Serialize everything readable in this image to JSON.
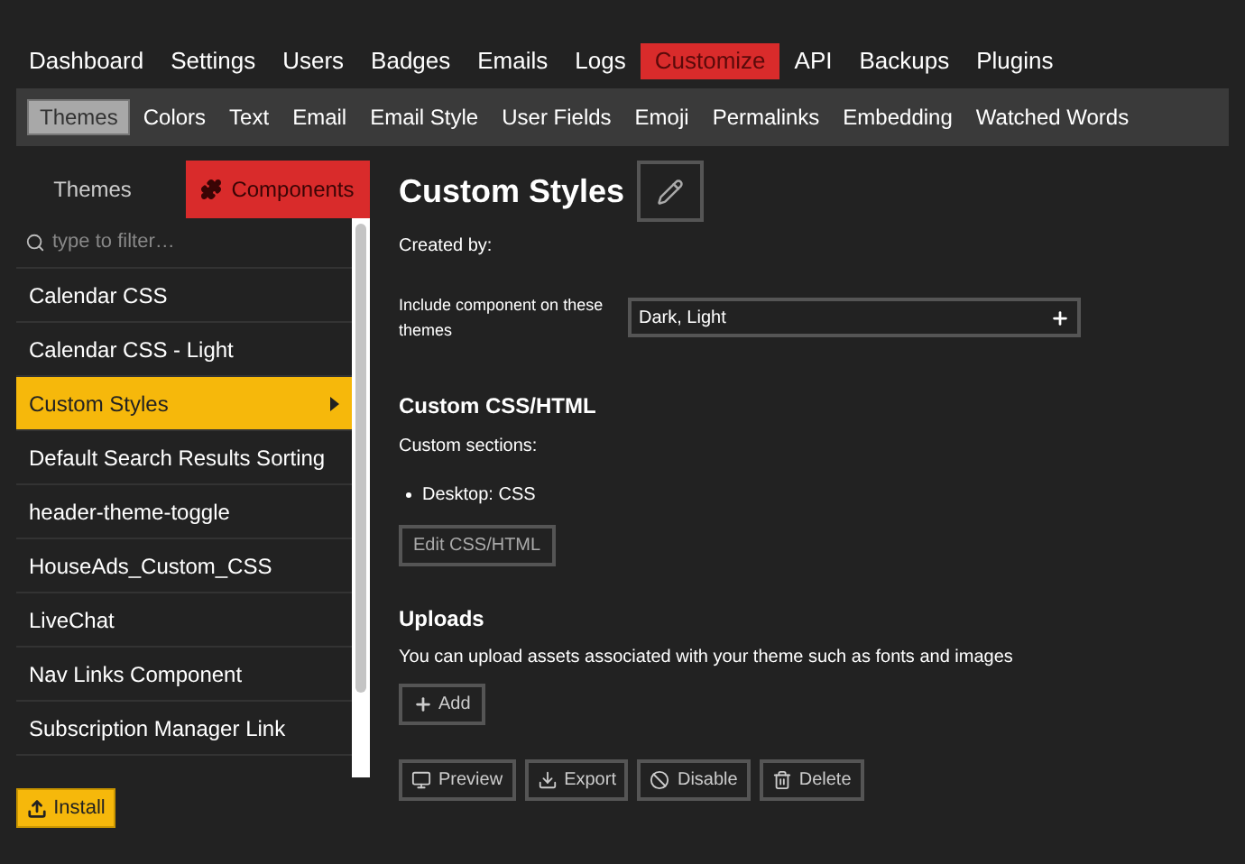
{
  "top_nav": [
    {
      "label": "Dashboard",
      "selected": false
    },
    {
      "label": "Settings",
      "selected": false
    },
    {
      "label": "Users",
      "selected": false
    },
    {
      "label": "Badges",
      "selected": false
    },
    {
      "label": "Emails",
      "selected": false
    },
    {
      "label": "Logs",
      "selected": false
    },
    {
      "label": "Customize",
      "selected": true
    },
    {
      "label": "API",
      "selected": false
    },
    {
      "label": "Backups",
      "selected": false
    },
    {
      "label": "Plugins",
      "selected": false
    }
  ],
  "sub_nav": [
    {
      "label": "Themes",
      "selected": true
    },
    {
      "label": "Colors",
      "selected": false
    },
    {
      "label": "Text",
      "selected": false
    },
    {
      "label": "Email",
      "selected": false
    },
    {
      "label": "Email Style",
      "selected": false
    },
    {
      "label": "User Fields",
      "selected": false
    },
    {
      "label": "Emoji",
      "selected": false
    },
    {
      "label": "Permalinks",
      "selected": false
    },
    {
      "label": "Embedding",
      "selected": false
    },
    {
      "label": "Watched Words",
      "selected": false
    }
  ],
  "sidebar": {
    "tabs": [
      {
        "label": "Themes",
        "selected": false
      },
      {
        "label": "Components",
        "selected": true
      }
    ],
    "filter": {
      "placeholder": "type to filter…"
    },
    "items": [
      {
        "label": "Calendar CSS",
        "selected": false
      },
      {
        "label": "Calendar CSS - Light",
        "selected": false
      },
      {
        "label": "Custom Styles",
        "selected": true
      },
      {
        "label": "Default Search Results Sorting",
        "selected": false
      },
      {
        "label": "header-theme-toggle",
        "selected": false
      },
      {
        "label": "HouseAds_Custom_CSS",
        "selected": false
      },
      {
        "label": "LiveChat",
        "selected": false
      },
      {
        "label": "Nav Links Component",
        "selected": false
      },
      {
        "label": "Subscription Manager Link",
        "selected": false
      }
    ],
    "install_button": "Install"
  },
  "detail": {
    "title": "Custom Styles",
    "created_by": "Created by:",
    "include_label": "Include component on these themes",
    "include_value": "Dark, Light",
    "css_heading": "Custom CSS/HTML",
    "sections_label": "Custom sections:",
    "sections": [
      "Desktop: CSS"
    ],
    "edit_button": "Edit CSS/HTML",
    "uploads_heading": "Uploads",
    "uploads_text": "You can upload assets associated with your theme such as fonts and images",
    "add_button": "Add",
    "actions": [
      {
        "kind": "preview",
        "label": "Preview"
      },
      {
        "kind": "export",
        "label": "Export"
      },
      {
        "kind": "disable",
        "label": "Disable"
      },
      {
        "kind": "delete",
        "label": "Delete"
      }
    ]
  }
}
